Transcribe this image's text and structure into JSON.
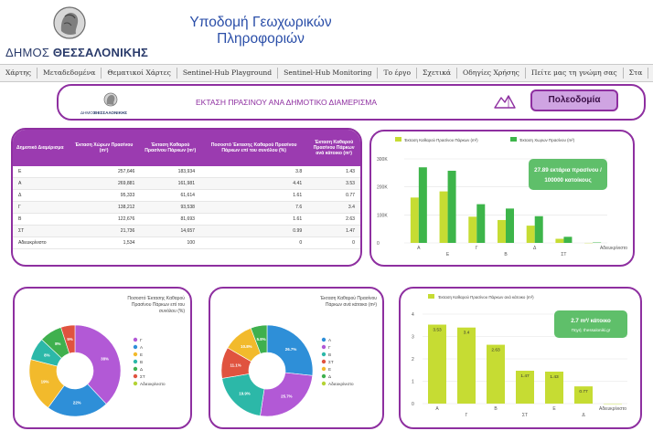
{
  "header": {
    "site_title": "Υποδομή Γεωχωρικών Πληροφοριών",
    "city_prefix": "ΔΗΜΟΣ",
    "city_name": "ΘΕΣΣΑΛΟΝΙΚΗΣ"
  },
  "nav": {
    "items": [
      "Χάρτης",
      "Μεταδεδομένα",
      "Θεματικοί Χάρτες",
      "Sentinel-Hub Playground",
      "Sentinel-Hub Monitoring",
      "Το έργο",
      "Σχετικά",
      "Οδηγίες Χρήσης",
      "Πείτε μας τη γνώμη σας",
      "Στα"
    ]
  },
  "banner": {
    "logo_city_prefix": "ΔΗΜΟΣ",
    "logo_city_name": "ΘΕΣΣΑΛΟΝΙΚΗΣ",
    "title": "ΕΚΤΑΣΗ ΠΡΑΣΙΝΟΥ ΑΝΑ ΔΗΜΟΤΙΚΟ ΔΙΑΜΕΡΙΣΜΑ",
    "button_label": "Πολεοδομία"
  },
  "table": {
    "headers": [
      "Δημοτικό Διαμέρισμα",
      "Έκταση Χώρων Πρασίνου (m²)",
      "Έκταση Καθαρού Πρασίνου Πάρκων (m²)",
      "Ποσοστό Έκτασης Καθαρού Πρασίνου Πάρκων επί του συνόλου (%)",
      "Έκταση Καθαρού Πρασίνου Πάρκων ανά κάτοικο (m²)"
    ],
    "rows": [
      [
        "Ε",
        "257,646",
        "183,934",
        "3.8",
        "1.43"
      ],
      [
        "Α",
        "269,881",
        "161,981",
        "4.41",
        "3.53"
      ],
      [
        "Δ",
        "95,333",
        "61,614",
        "1.61",
        "0.77"
      ],
      [
        "Γ",
        "138,212",
        "93,538",
        "7.6",
        "3.4"
      ],
      [
        "Β",
        "122,676",
        "81,693",
        "1.61",
        "2.63"
      ],
      [
        "ΣΤ",
        "21,736",
        "14,657",
        "0.99",
        "1.47"
      ],
      [
        "Αδιευκρίνιστο",
        "1,534",
        "100",
        "0",
        "0"
      ]
    ]
  },
  "chart_data": [
    {
      "type": "bar",
      "legend": [
        "Έκταση Καθαρού Πρασίνου Πάρκων (m²)",
        "Έκταση Χωρων Πρασίνου (m²)"
      ],
      "categories": [
        "Α",
        "Ε",
        "Γ",
        "Β",
        "Δ",
        "ΣΤ",
        "Αδιευκρίνιστο"
      ],
      "series": [
        {
          "name": "Έκταση Καθαρού Πρασίνου Πάρκων (m²)",
          "values": [
            161981,
            183934,
            93538,
            81693,
            61614,
            14657,
            100
          ],
          "color": "#c6dc33"
        },
        {
          "name": "Έκταση Χωρων Πρασίνου (m²)",
          "values": [
            269881,
            257646,
            138212,
            122676,
            95333,
            21736,
            1534
          ],
          "color": "#3db54a"
        }
      ],
      "yticks": [
        "300K",
        "200K",
        "100K",
        "0"
      ],
      "ylim": [
        0,
        300000
      ],
      "callout": {
        "line1": "27.89 εκτάρια πρασίνου /",
        "line2": "100000 κατοίκους"
      }
    },
    {
      "type": "pie",
      "title": [
        "Ποσοστό Έκτασης Καθαρού",
        "Πρασίνου Πάρκων επί του",
        "συνόλου (%)"
      ],
      "slices": [
        {
          "label": "Γ",
          "value": 38,
          "text": "38%",
          "color": "#b259d6"
        },
        {
          "label": "Α",
          "value": 22,
          "text": "22%",
          "color": "#2e8fd8"
        },
        {
          "label": "Ε",
          "value": 19,
          "text": "19%",
          "color": "#f2ba2c"
        },
        {
          "label": "Β",
          "value": 8,
          "text": "8%",
          "color": "#2cb8a8"
        },
        {
          "label": "Δ",
          "value": 8,
          "text": "8%",
          "color": "#3fb04e"
        },
        {
          "label": "ΣΤ",
          "value": 5,
          "text": "5%",
          "color": "#e0533f"
        },
        {
          "label": "Αδιευκρίνιστο",
          "value": 0,
          "text": "",
          "color": "#b4d335"
        }
      ]
    },
    {
      "type": "pie",
      "title": [
        "Έκταση Καθαρού Πρασίνου",
        "Πάρκων ανά κάτοικο (m²)"
      ],
      "slices": [
        {
          "label": "Α",
          "value": 26.7,
          "text": "26.7%",
          "color": "#2e8fd8"
        },
        {
          "label": "Γ",
          "value": 25.7,
          "text": "25.7%",
          "color": "#b259d6"
        },
        {
          "label": "Β",
          "value": 19.9,
          "text": "19.9%",
          "color": "#2cb8a8"
        },
        {
          "label": "ΣΤ",
          "value": 11.1,
          "text": "11.1%",
          "color": "#e0533f"
        },
        {
          "label": "Ε",
          "value": 10.8,
          "text": "10.8%",
          "color": "#f2ba2c"
        },
        {
          "label": "Δ",
          "value": 5.8,
          "text": "5.8%",
          "color": "#3fb04e"
        },
        {
          "label": "Αδιευκρίνιστο",
          "value": 0,
          "text": "",
          "color": "#b4d335"
        }
      ]
    },
    {
      "type": "bar",
      "legend": [
        "Έκταση Καθαρού Πρασίνου Πάρκων ανά κάτοικο (m²)"
      ],
      "categories": [
        "Α",
        "Γ",
        "Β",
        "ΣΤ",
        "Ε",
        "Δ",
        "Αδιευκρίνιστο"
      ],
      "series": [
        {
          "name": "Έκταση Καθαρού Πρασίνου Πάρκων ανά κάτοικο (m²)",
          "values": [
            3.53,
            3.4,
            2.63,
            1.47,
            1.43,
            0.77,
            0
          ],
          "labels": [
            "3.53",
            "3.4",
            "2.63",
            "1.47",
            "1.43",
            "0.77",
            ""
          ],
          "color": "#c6dc33"
        }
      ],
      "yticks": [
        "4",
        "3",
        "2",
        "1",
        "0"
      ],
      "ylim": [
        0,
        4
      ],
      "callout": {
        "line1": "2.7 m²/ κάτοικο",
        "line2": "Πηγή: thessaloniki.gr"
      }
    }
  ],
  "colors": {
    "accent": "#8e2fa0",
    "header_text": "#2a4ea8",
    "button_bg": "#cfa4e2"
  }
}
